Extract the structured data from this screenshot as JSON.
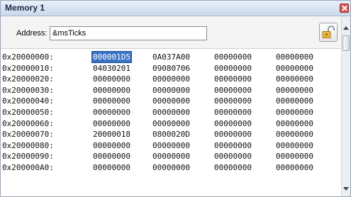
{
  "window": {
    "title": "Memory 1"
  },
  "toolbar": {
    "address_label": "Address:",
    "address_value": "&msTicks",
    "lock_icon": "unlock-icon"
  },
  "memory": {
    "rows": [
      {
        "address": "0x20000000:",
        "values": [
          "000001D5",
          "0A037A00",
          "00000000",
          "00000000"
        ]
      },
      {
        "address": "0x20000010:",
        "values": [
          "04030201",
          "09080706",
          "00000000",
          "00000000"
        ]
      },
      {
        "address": "0x20000020:",
        "values": [
          "00000000",
          "00000000",
          "00000000",
          "00000000"
        ]
      },
      {
        "address": "0x20000030:",
        "values": [
          "00000000",
          "00000000",
          "00000000",
          "00000000"
        ]
      },
      {
        "address": "0x20000040:",
        "values": [
          "00000000",
          "00000000",
          "00000000",
          "00000000"
        ]
      },
      {
        "address": "0x20000050:",
        "values": [
          "00000000",
          "00000000",
          "00000000",
          "00000000"
        ]
      },
      {
        "address": "0x20000060:",
        "values": [
          "00000000",
          "00000000",
          "00000000",
          "00000000"
        ]
      },
      {
        "address": "0x20000070:",
        "values": [
          "20000018",
          "0800020D",
          "00000000",
          "00000000"
        ]
      },
      {
        "address": "0x20000080:",
        "values": [
          "00000000",
          "00000000",
          "00000000",
          "00000000"
        ]
      },
      {
        "address": "0x20000090:",
        "values": [
          "00000000",
          "00000000",
          "00000000",
          "00000000"
        ]
      },
      {
        "address": "0x200000A0:",
        "values": [
          "00000000",
          "00000000",
          "00000000",
          "00000000"
        ]
      }
    ],
    "selected_color": "#3b73c4"
  }
}
